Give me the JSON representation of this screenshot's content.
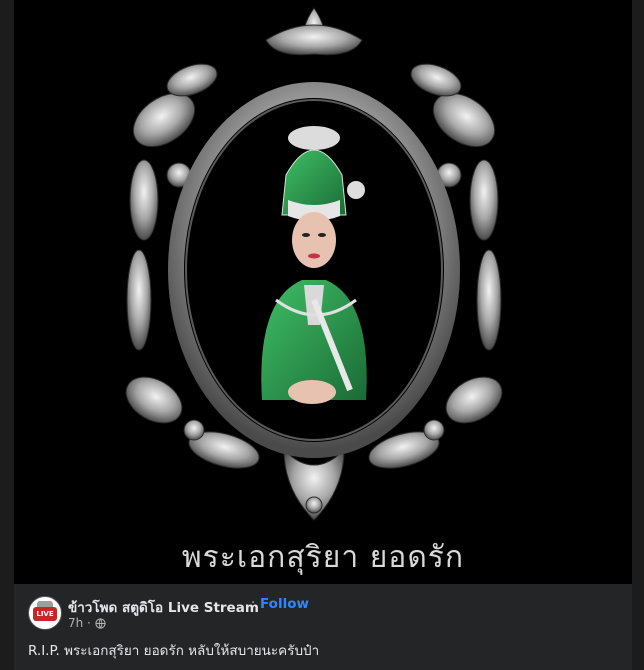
{
  "image": {
    "caption": "พระเอกสุริยา ยอดรัก"
  },
  "post": {
    "page_name": "ข้าวโพด สตูดิโอ Live Stream",
    "separator": "·",
    "follow_label": "Follow",
    "time": "7h ·",
    "text": "R.I.P. พระเอกสุริยา ยอดรัก หลับให้สบายนะครับป๋า",
    "avatar_badge": "LIVE",
    "icons": {
      "privacy": "globe-icon"
    },
    "colors": {
      "accent": "#2d88ff",
      "costume": "#2e9e4f"
    }
  }
}
